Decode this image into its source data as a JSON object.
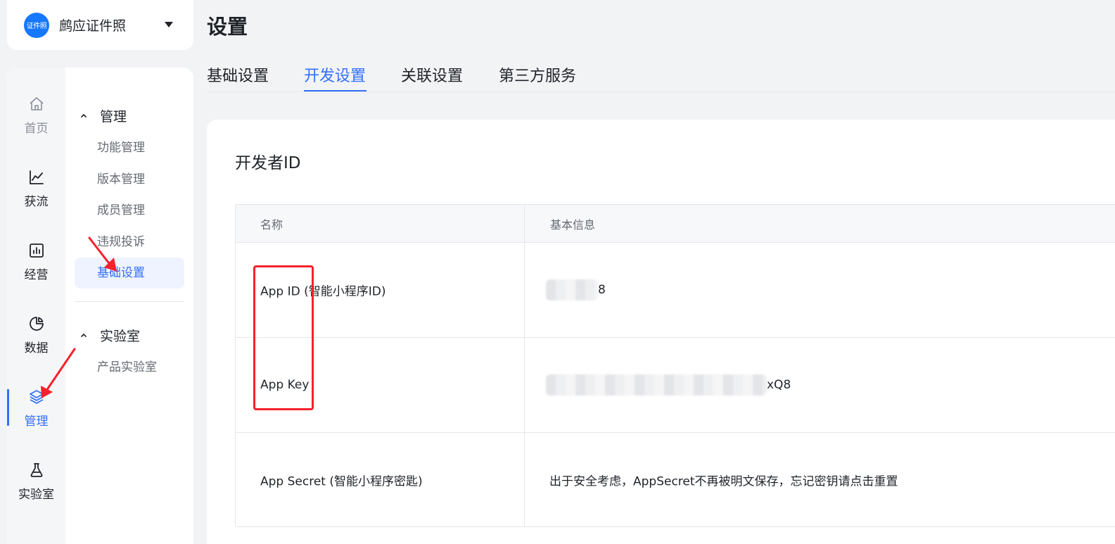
{
  "app": {
    "logo_text": "证件照",
    "name": "鹧应证件照"
  },
  "rail": [
    {
      "label": "首页",
      "icon": "home-icon"
    },
    {
      "label": "获流",
      "icon": "line-chart-icon"
    },
    {
      "label": "经营",
      "icon": "bar-chart-icon"
    },
    {
      "label": "数据",
      "icon": "pie-chart-icon"
    },
    {
      "label": "管理",
      "icon": "layers-icon",
      "active": true
    },
    {
      "label": "实验室",
      "icon": "flask-icon"
    }
  ],
  "submenu": {
    "groups": [
      {
        "title": "管理",
        "items": [
          "功能管理",
          "版本管理",
          "成员管理",
          "违规投诉",
          "基础设置"
        ],
        "active_item": "基础设置"
      },
      {
        "title": "实验室",
        "items": [
          "产品实验室"
        ]
      }
    ]
  },
  "page": {
    "title": "设置"
  },
  "tabs": [
    {
      "label": "基础设置"
    },
    {
      "label": "开发设置",
      "active": true
    },
    {
      "label": "关联设置"
    },
    {
      "label": "第三方服务"
    }
  ],
  "developer": {
    "section_title": "开发者ID",
    "columns": [
      "名称",
      "基本信息"
    ],
    "rows": [
      {
        "name": "App ID (智能小程序ID)",
        "value_suffix": "8",
        "masked": true
      },
      {
        "name": "App Key",
        "value_suffix": "xQ8",
        "masked": true
      },
      {
        "name": "App Secret (智能小程序密匙)",
        "value": "出于安全考虑，AppSecret不再被明文保存，忘记密钥请点击重置",
        "masked": false
      }
    ]
  },
  "colors": {
    "accent": "#3370ff",
    "annotation": "#f5222d"
  }
}
